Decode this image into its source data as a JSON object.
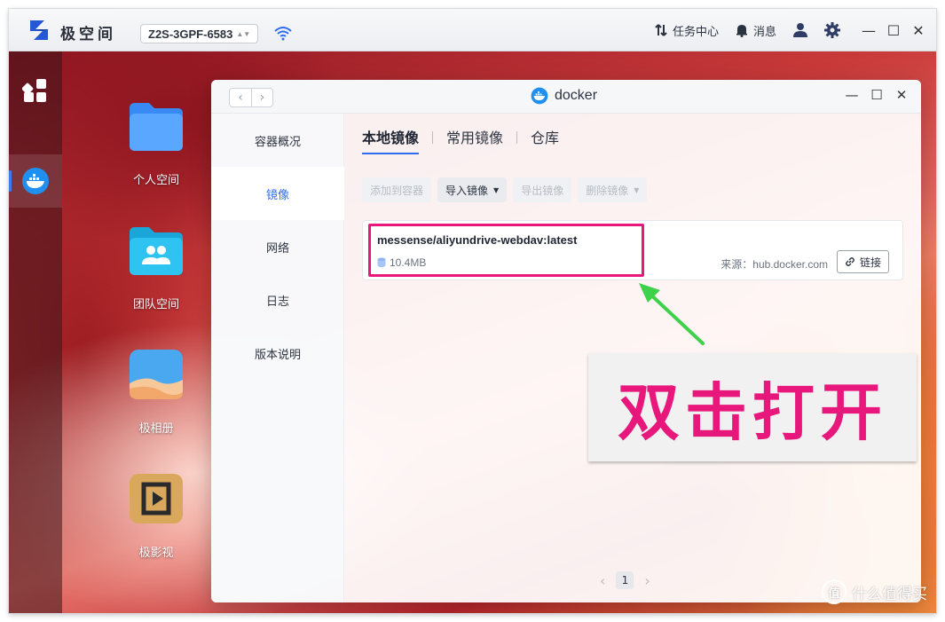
{
  "system": {
    "brand": "极空间",
    "device": "Z2S-3GPF-6583",
    "task_center": "任务中心",
    "messages": "消息"
  },
  "desktop": {
    "apps": [
      {
        "label": "个人空间"
      },
      {
        "label": "团队空间"
      },
      {
        "label": "极相册"
      },
      {
        "label": "极影视"
      }
    ]
  },
  "window": {
    "title": "docker",
    "sidebar": [
      {
        "label": "容器概况"
      },
      {
        "label": "镜像"
      },
      {
        "label": "网络"
      },
      {
        "label": "日志"
      },
      {
        "label": "版本说明"
      }
    ],
    "tabs": [
      {
        "label": "本地镜像"
      },
      {
        "label": "常用镜像"
      },
      {
        "label": "仓库"
      }
    ],
    "toolbar": {
      "add_to_container": "添加到容器",
      "import_image": "导入镜像",
      "export_image": "导出镜像",
      "delete_image": "删除镜像"
    },
    "image_card": {
      "name": "messense/aliyundrive-webdav:latest",
      "size": "10.4MB",
      "source": "来源：hub.docker.com",
      "link_label": "链接"
    },
    "pagination": {
      "current_page": "1"
    }
  },
  "annotation": {
    "callout_text": "双击打开",
    "highlight_color": "#e8177b",
    "arrow_color": "#3fd14a"
  },
  "watermark": {
    "text": "什么值得买",
    "icon_text": "值"
  },
  "colors": {
    "accent": "#2f6df0",
    "callout": "#e8177b"
  }
}
